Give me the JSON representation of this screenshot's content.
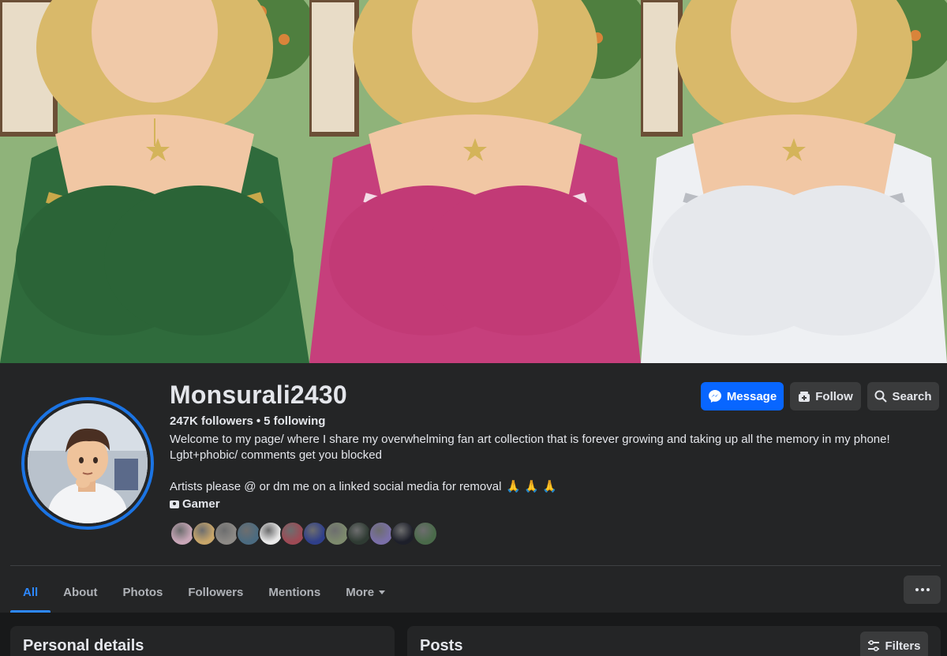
{
  "profile": {
    "name": "Monsurali2430",
    "followers": "247K followers",
    "following": "5 following",
    "separator": "•",
    "bio_line1": "Welcome to my page/ where I share my overwhelming fan art collection that is forever growing and taking up all the memory in my phone!",
    "bio_line2": "Lgbt+phobic/ comments get you blocked",
    "bio_line3": "Artists please @ or dm me on a linked social media for removal",
    "bio_emoji": "🙏 🙏 🙏",
    "category": "Gamer"
  },
  "buttons": {
    "message": "Message",
    "follow": "Follow",
    "search": "Search",
    "filters": "Filters"
  },
  "tabs": [
    "All",
    "About",
    "Photos",
    "Followers",
    "Mentions",
    "More"
  ],
  "sections": {
    "personal_details": "Personal details",
    "posts": "Posts"
  },
  "colors": {
    "accent": "#0866ff",
    "active_tab": "#2d88ff",
    "surface": "#242526",
    "background": "#18191a"
  },
  "follower_avatar_colors": [
    "#c9a7b8",
    "#c8a66a",
    "#8d8a86",
    "#4b6b80",
    "#e9e9e9",
    "#9e4a55",
    "#2f3f8a",
    "#7d8a6d",
    "#2f3b33",
    "#7a6fa8",
    "#1d1f2a",
    "#4a6a4a"
  ]
}
